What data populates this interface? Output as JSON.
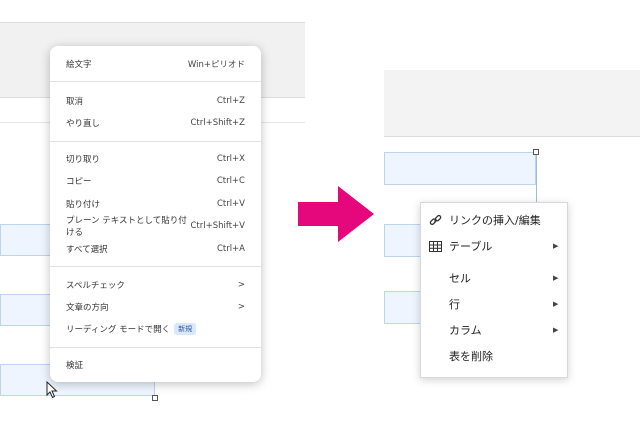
{
  "left_menu": {
    "groups": [
      [
        {
          "label": "絵文字",
          "shortcut": "Win+ピリオド"
        }
      ],
      [
        {
          "label": "取消",
          "shortcut": "Ctrl+Z"
        },
        {
          "label": "やり直し",
          "shortcut": "Ctrl+Shift+Z"
        }
      ],
      [
        {
          "label": "切り取り",
          "shortcut": "Ctrl+X"
        },
        {
          "label": "コピー",
          "shortcut": "Ctrl+C"
        },
        {
          "label": "貼り付け",
          "shortcut": "Ctrl+V"
        },
        {
          "label": "プレーン テキストとして貼り付ける",
          "shortcut": "Ctrl+Shift+V"
        },
        {
          "label": "すべて選択",
          "shortcut": "Ctrl+A"
        }
      ],
      [
        {
          "label": "スペルチェック",
          "shortcut": ">"
        },
        {
          "label": "文章の方向",
          "shortcut": ">"
        },
        {
          "label": "リーディング モードで開く",
          "shortcut": "",
          "badge": "新規"
        }
      ],
      [
        {
          "label": "検証",
          "shortcut": ""
        }
      ]
    ]
  },
  "right_menu": {
    "items": [
      {
        "label": "リンクの挿入/編集",
        "icon": "link-icon",
        "submenu": false
      },
      {
        "label": "テーブル",
        "icon": "table-icon",
        "submenu": true
      },
      {
        "label": "セル",
        "icon": "",
        "submenu": true
      },
      {
        "label": "行",
        "icon": "",
        "submenu": true
      },
      {
        "label": "カラム",
        "icon": "",
        "submenu": true
      },
      {
        "label": "表を削除",
        "icon": "",
        "submenu": false
      }
    ],
    "submenu_glyph": "▶"
  },
  "colors": {
    "arrow": "#e5087c",
    "selection": "#eef5ff",
    "selection_border": "#bcd4ee"
  }
}
